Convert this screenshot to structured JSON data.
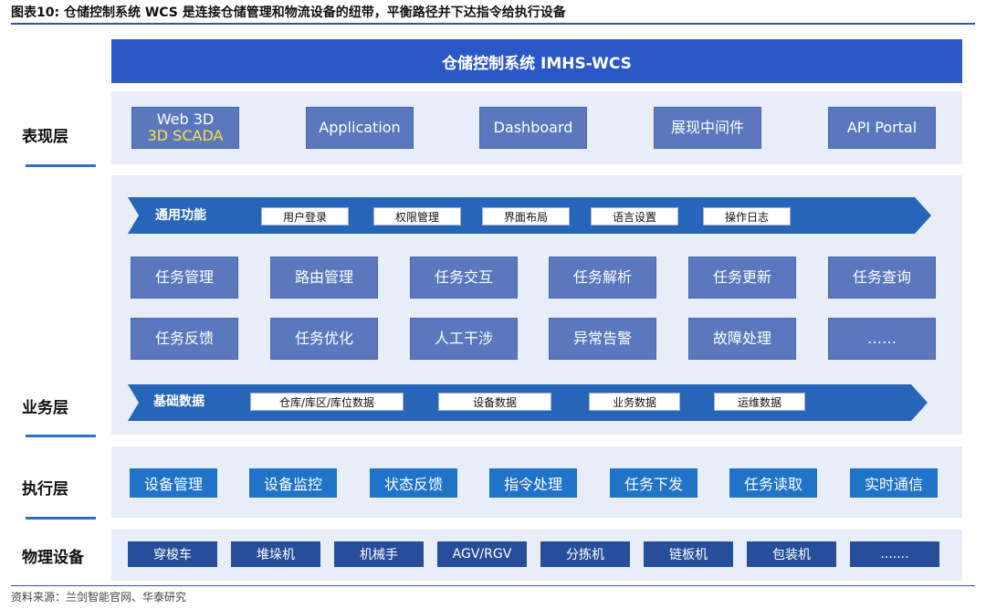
{
  "header": {
    "title": "图表10:  仓储控制系统 WCS 是连接仓储管理和物流设备的纽带，平衡路径并下达指令给执行设备"
  },
  "banner": {
    "title": "仓储控制系统 IMHS-WCS"
  },
  "layers": {
    "presentation": "表现层",
    "business": "业务层",
    "execution": "执行层",
    "physical": "物理设备"
  },
  "presentation_items": [
    {
      "label": "Web 3D",
      "sub": "3D SCADA"
    },
    {
      "label": "Application",
      "sub": ""
    },
    {
      "label": "Dashboard",
      "sub": ""
    },
    {
      "label": "展现中间件",
      "sub": ""
    },
    {
      "label": "API Portal",
      "sub": ""
    }
  ],
  "common_functions": {
    "title": "通用功能",
    "chips": [
      "用户登录",
      "权限管理",
      "界面布局",
      "语言设置",
      "操作日志"
    ]
  },
  "business_row1": [
    "任务管理",
    "路由管理",
    "任务交互",
    "任务解析",
    "任务更新",
    "任务查询"
  ],
  "business_row2": [
    "任务反馈",
    "任务优化",
    "人工干涉",
    "异常告警",
    "故障处理",
    "……"
  ],
  "base_data": {
    "title": "基础数据",
    "chips": [
      "仓库/库区/库位数据",
      "设备数据",
      "业务数据",
      "运维数据"
    ]
  },
  "execution_items": [
    "设备管理",
    "设备监控",
    "状态反馈",
    "指令处理",
    "任务下发",
    "任务读取",
    "实时通信"
  ],
  "physical_items": [
    "穿梭车",
    "堆垛机",
    "机械手",
    "AGV/RGV",
    "分拣机",
    "链板机",
    "包装机",
    "......."
  ],
  "source": "资料来源：兰剑智能官网、华泰研究",
  "colors": {
    "banner": "#2a58c6",
    "presentation_box": "#5b78be",
    "execution_button": "#1f73c8",
    "device_button": "#274e9a",
    "panel": "#e7eef8",
    "highlight_text": "#ffe03a"
  }
}
